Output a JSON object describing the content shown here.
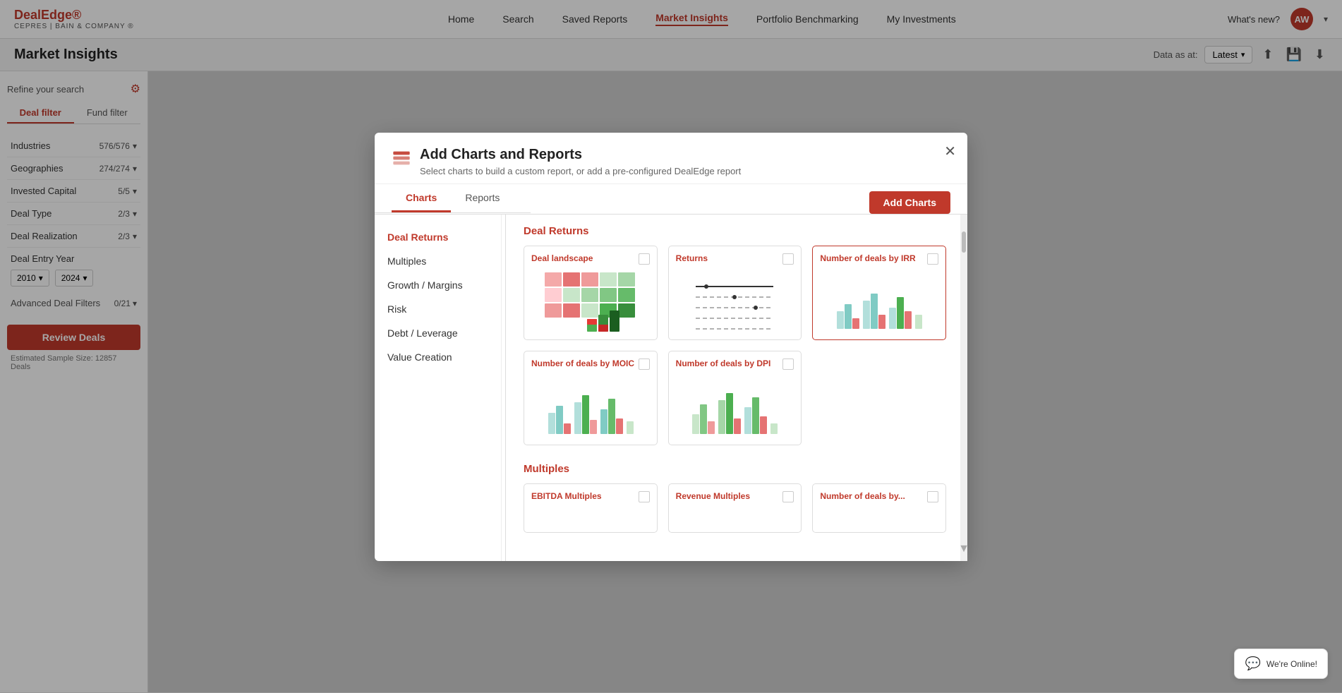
{
  "brand": {
    "name": "DealEdge®",
    "sub": "CEPRES | BAIN & COMPANY ®"
  },
  "nav": {
    "links": [
      "Home",
      "Search",
      "Saved Reports",
      "Market Insights",
      "Portfolio Benchmarking",
      "My Investments"
    ],
    "active": "Market Insights",
    "whats_new": "What's new?",
    "avatar": "AW"
  },
  "page_title": "Market Insights",
  "header": {
    "data_as_at": "Data as at:",
    "latest": "Latest",
    "icons": [
      "share",
      "save",
      "download"
    ]
  },
  "sidebar": {
    "refine": "Refine your search",
    "tabs": [
      "Deal filter",
      "Fund filter"
    ],
    "active_tab": "Deal filter",
    "filters": [
      {
        "label": "Industries",
        "value": "576/576"
      },
      {
        "label": "Geographies",
        "value": "274/274"
      },
      {
        "label": "Invested Capital",
        "value": "5/5"
      },
      {
        "label": "Deal Type",
        "value": "2/3"
      },
      {
        "label": "Deal Realization",
        "value": "2/3"
      }
    ],
    "deal_entry_year": {
      "label": "Deal Entry Year",
      "from": "2010",
      "to": "2024"
    },
    "advanced_filters": {
      "label": "Advanced Deal Filters",
      "value": "0/21"
    },
    "review_btn": "Review Deals",
    "estimated": "Estimated Sample Size: 12857 Deals"
  },
  "modal": {
    "title": "Add Charts and Reports",
    "subtitle": "Select charts to build a custom report, or add a pre-configured DealEdge report",
    "tabs": [
      "Charts",
      "Reports"
    ],
    "active_tab": "Charts",
    "add_btn": "Add Charts",
    "categories": [
      {
        "label": "Deal Returns",
        "active": true
      },
      {
        "label": "Multiples"
      },
      {
        "label": "Growth / Margins"
      },
      {
        "label": "Risk"
      },
      {
        "label": "Debt / Leverage"
      },
      {
        "label": "Value Creation"
      }
    ],
    "sections": [
      {
        "title": "Deal Returns",
        "charts": [
          {
            "title": "Deal landscape",
            "type": "heatmap"
          },
          {
            "title": "Returns",
            "type": "linechart"
          },
          {
            "title": "Number of deals by IRR",
            "type": "barchart_irr"
          },
          {
            "title": "Number of deals by MOIC",
            "type": "barchart_moic"
          },
          {
            "title": "Number of deals by DPI",
            "type": "barchart_dpi"
          }
        ]
      },
      {
        "title": "Multiples",
        "charts": [
          {
            "title": "EBITDA Multiples",
            "type": "partial"
          },
          {
            "title": "Revenue Multiples",
            "type": "partial"
          },
          {
            "title": "Number of deals by...",
            "type": "partial"
          }
        ]
      }
    ]
  },
  "chat": {
    "icon": "💬",
    "label": "We're Online!"
  }
}
